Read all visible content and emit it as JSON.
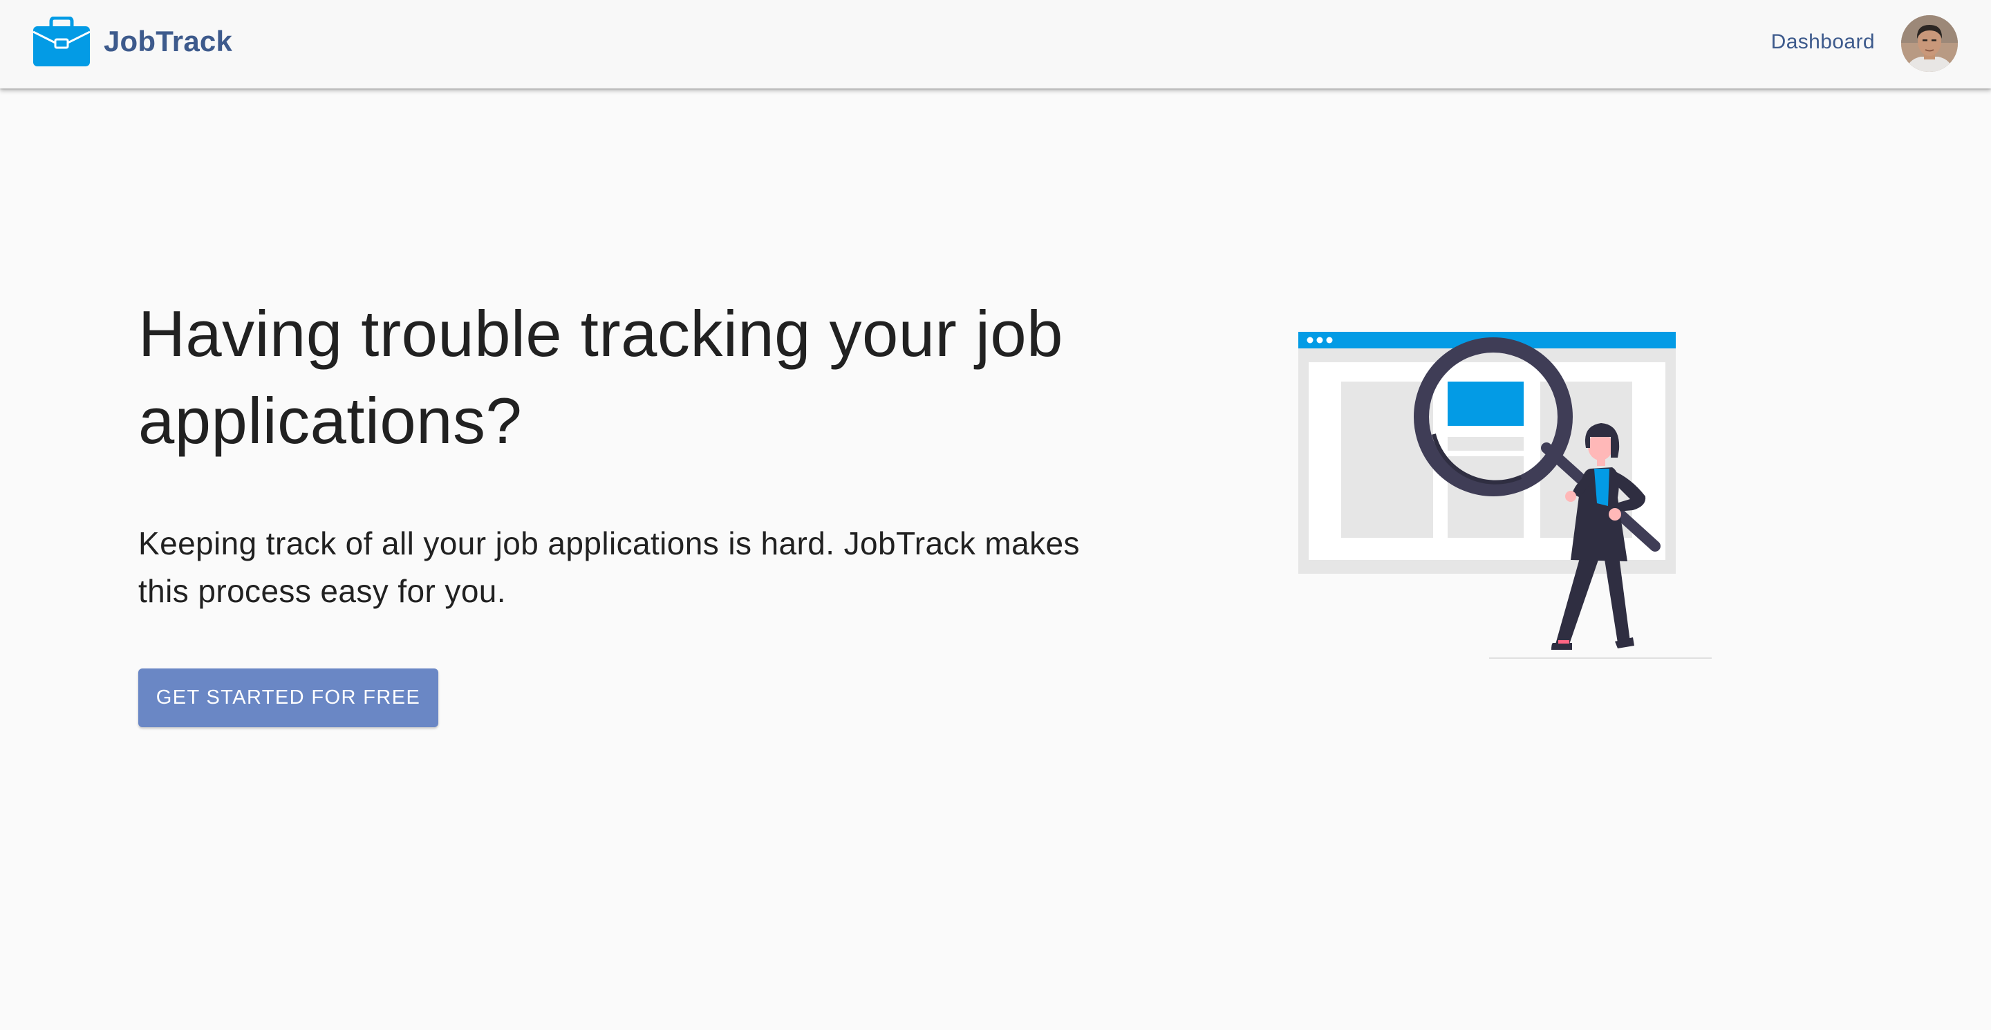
{
  "app": {
    "name": "JobTrack",
    "brand_icon": "briefcase-icon",
    "accent_color": "#039be5",
    "brand_color": "#3d5a8c"
  },
  "nav": {
    "dashboard_label": "Dashboard",
    "avatar_icon": "user-avatar"
  },
  "hero": {
    "title": "Having trouble tracking your job applications?",
    "subtitle": "Keeping track of all your job applications is hard. JobTrack makes this process easy for you.",
    "cta_label": "GET STARTED FOR FREE",
    "cta_color": "#6a87c5",
    "illustration": "person-with-magnifying-glass-illustration"
  }
}
